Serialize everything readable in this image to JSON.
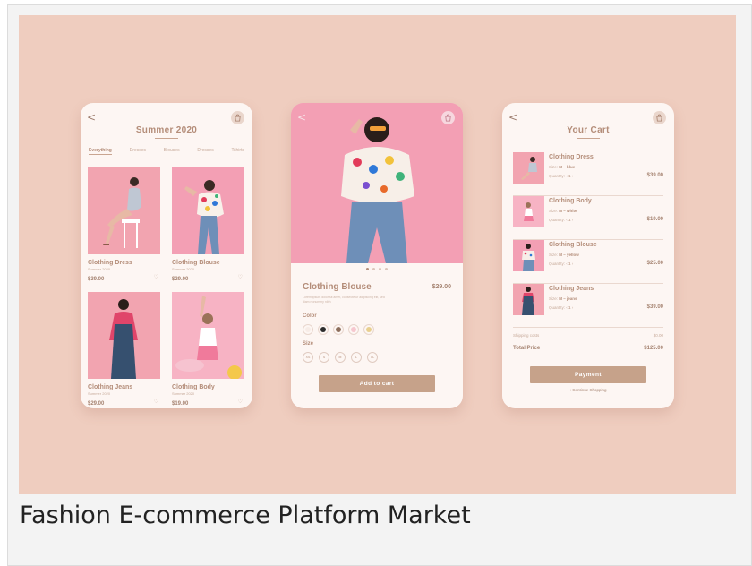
{
  "caption": "Fashion E-commerce Platform Market",
  "colors": {
    "banner": "#efcdbf",
    "accent": "#c6a28a",
    "text_brown": "#b48d79",
    "photo_pink": "#f2a7b3"
  },
  "icons": {
    "back": "chevron-left-icon",
    "bag": "shopping-bag-icon",
    "heart": "heart-icon"
  },
  "screen_list": {
    "back": "<",
    "title": "Summer 2020",
    "tabs": [
      "Everything",
      "Dresses",
      "Blouses",
      "Dresses",
      "Tshirts"
    ],
    "products": [
      {
        "name": "Clothing Dress",
        "sub": "Summer 2020",
        "price": "$39.00"
      },
      {
        "name": "Clothing Blouse",
        "sub": "Summer 2020",
        "price": "$29.00"
      },
      {
        "name": "Clothing Jeans",
        "sub": "Summer 2020",
        "price": "$29.00"
      },
      {
        "name": "Clothing Body",
        "sub": "Summer 2020",
        "price": "$19.00"
      }
    ]
  },
  "screen_detail": {
    "back": "<",
    "name": "Clothing Blouse",
    "price": "$29.00",
    "description": "Lorem ipsum dolor sit amet, consectetur adipiscing elit, sed diam nonummy nibh",
    "color_label": "Color",
    "colors": [
      "#f7ece7",
      "#2b2b2b",
      "#8c6e5c",
      "#f6c7cf",
      "#e8cf8f"
    ],
    "size_label": "Size",
    "sizes": [
      "XS",
      "S",
      "M",
      "L",
      "XL"
    ],
    "cta": "Add to cart"
  },
  "screen_cart": {
    "back": "<",
    "title": "Your Cart",
    "items": [
      {
        "name": "Clothing Dress",
        "size_label": "Size:",
        "size": "M – blue",
        "qty_label": "Quantity:",
        "qty": "1",
        "price": "$39.00"
      },
      {
        "name": "Clothing Body",
        "size_label": "Size:",
        "size": "M – white",
        "qty_label": "Quantity:",
        "qty": "1",
        "price": "$19.00"
      },
      {
        "name": "Clothing Blouse",
        "size_label": "Size:",
        "size": "M – yellow",
        "qty_label": "Quantity:",
        "qty": "1",
        "price": "$25.00"
      },
      {
        "name": "Clothing Jeans",
        "size_label": "Size:",
        "size": "M – jeans",
        "qty_label": "Quantity:",
        "qty": "1",
        "price": "$39.00"
      }
    ],
    "shipping_label": "Shipping costs",
    "shipping_value": "$0.00",
    "total_label": "Total Price",
    "total_value": "$125.00",
    "cta": "Payment",
    "continue": "‹ Continue Shopping"
  }
}
